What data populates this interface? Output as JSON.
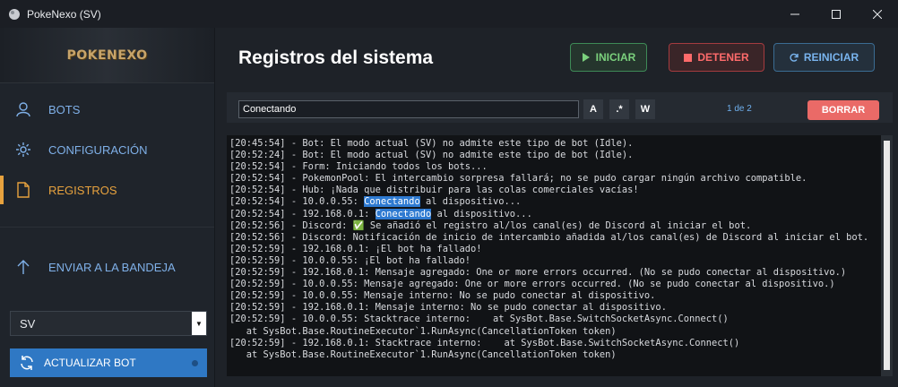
{
  "window": {
    "title": "PokeNexo (SV)",
    "minimize": "—",
    "maximize": "☐",
    "close": "✕"
  },
  "sidebar": {
    "logo": "POKENEXO",
    "items": [
      {
        "label": "BOTS",
        "icon": "user-icon"
      },
      {
        "label": "CONFIGURACIÓN",
        "icon": "gear-icon"
      },
      {
        "label": "REGISTROS",
        "icon": "document-icon",
        "active": true
      },
      {
        "label": "ENVIAR A LA BANDEJA",
        "icon": "arrow-up-icon"
      }
    ],
    "select_value": "SV",
    "update_label": "ACTUALIZAR BOT"
  },
  "main": {
    "title": "Registros del sistema",
    "start_label": "INICIAR",
    "stop_label": "DETENER",
    "restart_label": "REINICIAR"
  },
  "search": {
    "value": "Conectando",
    "case_label": "A",
    "regex_label": ".*",
    "word_label": "W",
    "match_count": "1 de 2",
    "clear_label": "BORRAR"
  },
  "colors": {
    "accent_active": "#e7a23e",
    "nav_text": "#7fb0e8",
    "start": "#7bd17d",
    "stop": "#ff6b6b",
    "restart": "#79b4ee",
    "clear": "#ea6a67",
    "highlight": "#2e7ad1"
  },
  "log": {
    "lines": [
      "[20:45:54] - Bot: El modo actual (SV) no admite este tipo de bot (Idle).",
      "[20:52:24] - Bot: El modo actual (SV) no admite este tipo de bot (Idle).",
      "[20:52:54] - Form: Iniciando todos los bots...",
      "[20:52:54] - PokemonPool: El intercambio sorpresa fallará; no se pudo cargar ningún archivo compatible.",
      "[20:52:54] - Hub: ¡Nada que distribuir para las colas comerciales vacías!",
      {
        "pre": "[20:52:54] - 10.0.0.55: ",
        "hl": "Conectando",
        "post": " al dispositivo..."
      },
      {
        "pre": "[20:52:54] - 192.168.0.1: ",
        "hl": "Conectando",
        "post": " al dispositivo..."
      },
      "[20:52:56] - Discord: ✅ Se añadió el registro al/los canal(es) de Discord al iniciar el bot.",
      "[20:52:56] - Discord: Notificación de inicio de intercambio añadida al/los canal(es) de Discord al iniciar el bot.",
      "[20:52:59] - 192.168.0.1: ¡El bot ha fallado!",
      "[20:52:59] - 10.0.0.55: ¡El bot ha fallado!",
      "[20:52:59] - 192.168.0.1: Mensaje agregado: One or more errors occurred. (No se pudo conectar al dispositivo.)",
      "[20:52:59] - 10.0.0.55: Mensaje agregado: One or more errors occurred. (No se pudo conectar al dispositivo.)",
      "[20:52:59] - 10.0.0.55: Mensaje interno: No se pudo conectar al dispositivo.",
      "[20:52:59] - 192.168.0.1: Mensaje interno: No se pudo conectar al dispositivo.",
      "[20:52:59] - 10.0.0.55: Stacktrace interno:    at SysBot.Base.SwitchSocketAsync.Connect()",
      "   at SysBot.Base.RoutineExecutor`1.RunAsync(CancellationToken token)",
      "[20:52:59] - 192.168.0.1: Stacktrace interno:    at SysBot.Base.SwitchSocketAsync.Connect()",
      "   at SysBot.Base.RoutineExecutor`1.RunAsync(CancellationToken token)"
    ]
  }
}
